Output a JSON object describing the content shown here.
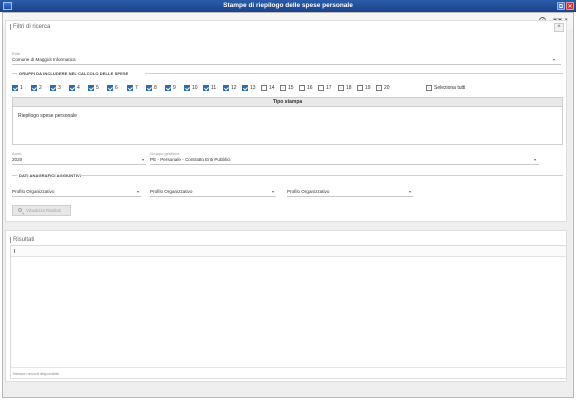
{
  "window": {
    "title": "Stampe di riepilogo delle spese personale"
  },
  "toolbar": {
    "help_icon": "?",
    "language_flag": "italian-flag-icon"
  },
  "filters": {
    "panel_title": "Filtri di ricerca",
    "collapse_symbol": "^",
    "ente": {
      "label": "Ente",
      "value": "Comune di Maggiol Informatica"
    },
    "gruppi_title": "GRUPPI DA INCLUDERE NEL CALCOLO DELLE SPESE",
    "gruppi": [
      {
        "label": "1",
        "checked": true
      },
      {
        "label": "2",
        "checked": true
      },
      {
        "label": "3",
        "checked": true
      },
      {
        "label": "4",
        "checked": true
      },
      {
        "label": "5",
        "checked": true
      },
      {
        "label": "6",
        "checked": true
      },
      {
        "label": "7",
        "checked": true
      },
      {
        "label": "8",
        "checked": true
      },
      {
        "label": "9",
        "checked": true
      },
      {
        "label": "10",
        "checked": true
      },
      {
        "label": "11",
        "checked": true
      },
      {
        "label": "12",
        "checked": true
      },
      {
        "label": "13",
        "checked": true
      },
      {
        "label": "14",
        "checked": false
      },
      {
        "label": "15",
        "checked": false
      },
      {
        "label": "16",
        "checked": false
      },
      {
        "label": "17",
        "checked": false
      },
      {
        "label": "18",
        "checked": false
      },
      {
        "label": "19",
        "checked": false
      },
      {
        "label": "20",
        "checked": false
      }
    ],
    "seleziona_tutti": {
      "label": "Seleziona tutti",
      "checked": false
    },
    "tipo_stampa": {
      "header": "Tipo stampa",
      "selected": "Riepilogo spese personale"
    },
    "anno": {
      "label": "Anno",
      "value": "2020"
    },
    "gruppo_gestione": {
      "label": "Gruppo gestione",
      "value": "PE - Personale - Contratto Enti Pubblici"
    },
    "dati_title": "DATI ANAGRAFICI AGGIUNTIVI",
    "profili": [
      {
        "value": "Profilo Organizzativo"
      },
      {
        "value": "Profilo Organizzativo"
      },
      {
        "value": "Profilo Organizzativo"
      }
    ],
    "visualizza_button": "Visualizza Risultati"
  },
  "results": {
    "panel_title": "Risultati",
    "empty_text": "Nessun record disponibile."
  },
  "colors": {
    "titlebar": "#1f4a93",
    "checkbox_checked": "#2f6fa8",
    "close_button": "#c9302c"
  }
}
